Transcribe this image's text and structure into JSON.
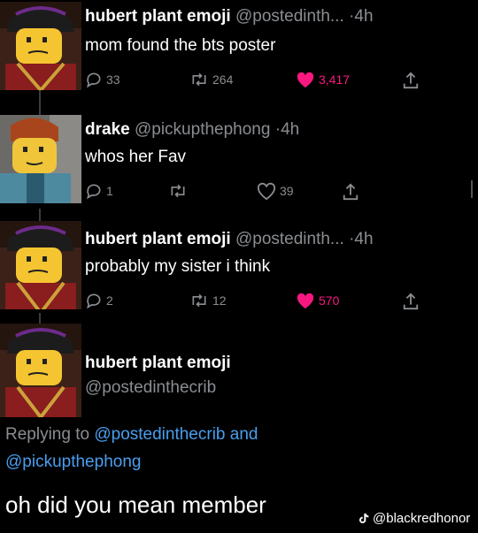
{
  "tweets": [
    {
      "name": "hubert plant emoji",
      "handle": "@postedinth...",
      "sep": "·",
      "time": "4h",
      "text": "mom found the bts poster",
      "replies": "33",
      "retweets": "264",
      "likes": "3,417",
      "liked": true
    },
    {
      "name": "drake",
      "handle": "@pickupthephong",
      "sep": "·",
      "time": "4h",
      "text": "whos her Fav",
      "replies": "1",
      "retweets": "",
      "likes": "39",
      "liked": false
    },
    {
      "name": "hubert plant emoji",
      "handle": "@postedinth...",
      "sep": "·",
      "time": "4h",
      "text": "probably my sister i think",
      "replies": "2",
      "retweets": "12",
      "likes": "570",
      "liked": true
    }
  ],
  "final": {
    "name": "hubert plant emoji",
    "handle": "@postedinthecrib",
    "replying_prefix": "Replying to",
    "mention_1": "@postedinthecrib",
    "and": "and",
    "mention_2": "@pickupthephong",
    "text": "oh did you mean member"
  },
  "watermark": "@blackredhonor",
  "colors": {
    "background": "#000000",
    "muted": "#8a8d91",
    "like": "#f91880",
    "mention": "#4a9eef"
  },
  "icons": [
    "reply-icon",
    "retweet-icon",
    "heart-icon",
    "share-icon",
    "tiktok-icon"
  ]
}
